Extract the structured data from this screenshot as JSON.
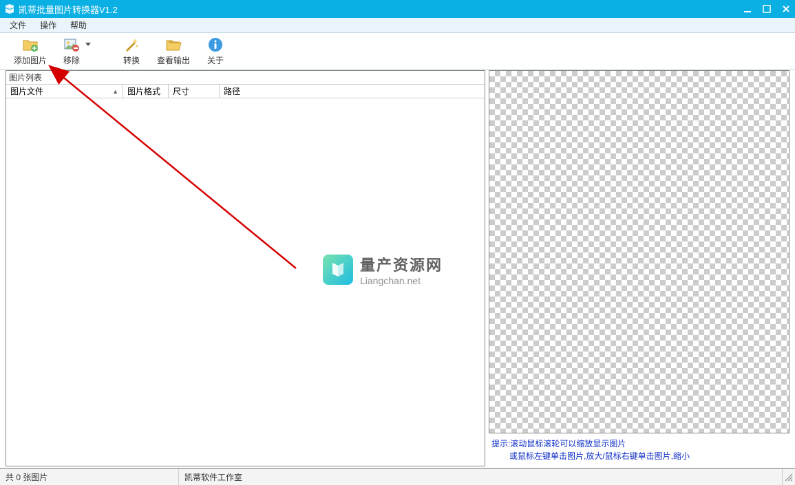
{
  "titlebar": {
    "title": "凯蒂批量图片转换器V1.2"
  },
  "menus": {
    "file": "文件",
    "operation": "操作",
    "help": "帮助"
  },
  "toolbar": {
    "add_image": "添加图片",
    "remove": "移除",
    "convert": "转换",
    "view_output": "查看输出",
    "about": "关于"
  },
  "left_panel": {
    "title": "图片列表",
    "columns": {
      "file": "图片文件",
      "format": "图片格式",
      "size": "尺寸",
      "path": "路径"
    }
  },
  "hints": {
    "line1": "提示:滚动鼠标滚轮可以缩放显示图片",
    "line2": "或鼠标左键单击图片,放大/鼠标右键单击图片,缩小"
  },
  "statusbar": {
    "count": "共 0 张图片",
    "studio": "凯蒂软件工作室"
  },
  "watermark": {
    "cn": "量产资源网",
    "en": "Liangchan.net"
  }
}
